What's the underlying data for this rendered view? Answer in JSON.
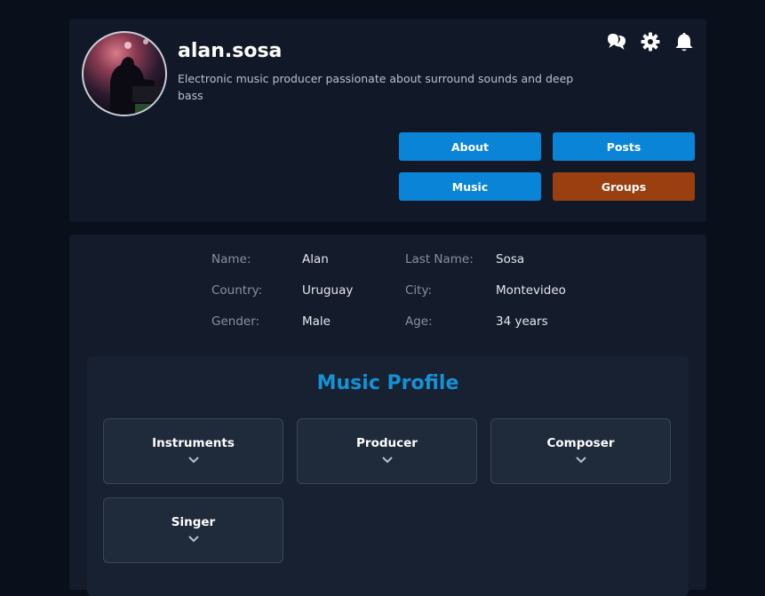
{
  "profile": {
    "username": "alan.sosa",
    "bio": "Electronic music producer passionate about surround sounds and deep bass"
  },
  "icons": {
    "chat": "chat-bubbles-icon",
    "settings": "gear-icon",
    "notifications": "bell-icon"
  },
  "nav": {
    "about": "About",
    "posts": "Posts",
    "music": "Music",
    "groups": "Groups"
  },
  "info": {
    "name_label": "Name:",
    "name_value": "Alan",
    "last_name_label": "Last Name:",
    "last_name_value": "Sosa",
    "country_label": "Country:",
    "country_value": "Uruguay",
    "city_label": "City:",
    "city_value": "Montevideo",
    "gender_label": "Gender:",
    "gender_value": "Male",
    "age_label": "Age:",
    "age_value": "34 years"
  },
  "music_profile": {
    "title": "Music Profile",
    "categories": [
      "Instruments",
      "Producer",
      "Composer",
      "Singer"
    ]
  },
  "colors": {
    "nav_button": "#0a84d6",
    "nav_button_active": "#9a3f10",
    "accent_title": "#1591d4"
  }
}
